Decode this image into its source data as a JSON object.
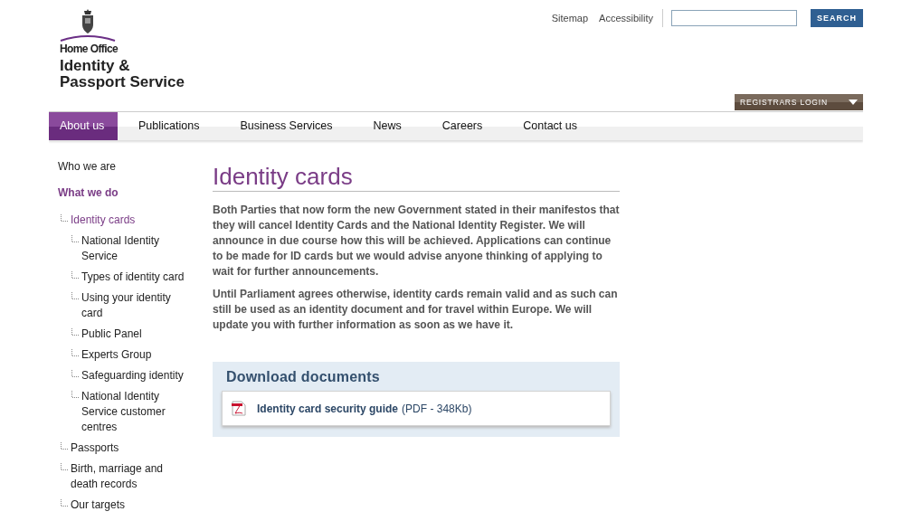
{
  "logo": {
    "department": "Home Office",
    "service_line_1": "Identity &",
    "service_line_2": "Passport Service"
  },
  "utility_links": [
    "Sitemap",
    "Accessibility"
  ],
  "search": {
    "button": "SEARCH"
  },
  "registrars_login": {
    "label": "REGISTRARS LOGIN"
  },
  "nav": [
    {
      "label": "About us",
      "selected": true
    },
    {
      "label": "Publications",
      "selected": false
    },
    {
      "label": "Business Services",
      "selected": false
    },
    {
      "label": "News",
      "selected": false
    },
    {
      "label": "Careers",
      "selected": false
    },
    {
      "label": "Contact us",
      "selected": false
    }
  ],
  "sidebar": [
    {
      "label": "Who we are",
      "selected": false
    },
    {
      "label": "What we do",
      "selected": true,
      "children": [
        {
          "label": "Identity cards",
          "selected": true,
          "children": [
            {
              "label": "National Identity Service",
              "selected": false
            },
            {
              "label": "Types of identity card",
              "selected": false
            },
            {
              "label": "Using your identity card",
              "selected": false
            },
            {
              "label": "Public Panel",
              "selected": false
            },
            {
              "label": "Experts Group",
              "selected": false
            },
            {
              "label": "Safeguarding identity",
              "selected": false
            },
            {
              "label": "National Identity Service customer centres",
              "selected": false
            }
          ]
        },
        {
          "label": "Passports",
          "selected": false
        },
        {
          "label": "Birth, marriage and death records",
          "selected": false
        },
        {
          "label": "Our targets",
          "selected": false
        }
      ]
    }
  ],
  "page": {
    "title": "Identity cards",
    "paragraphs": [
      "Both Parties that now form the new Government stated in their manifestos that they will cancel Identity Cards and the National Identity Register. We will announce in due course how this will be achieved. Applications can continue to be made for ID cards but we would advise anyone thinking of applying to wait for further announcements.",
      "Until Parliament agrees otherwise, identity cards remain valid and as such can still be used as an identity document and for travel within Europe. We will update you with further information as soon as we have it."
    ],
    "downloads": {
      "title": "Download documents",
      "items": [
        {
          "link": "Identity card security guide",
          "meta": "(PDF - 348Kb)"
        }
      ]
    }
  }
}
